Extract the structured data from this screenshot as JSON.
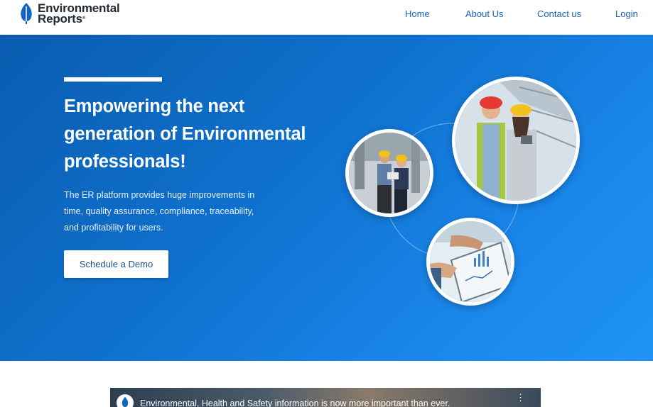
{
  "logo": {
    "line1": "Environmental",
    "line2": "Reports",
    "mark": "®"
  },
  "nav": {
    "items": [
      "Home",
      "About Us",
      "Contact us",
      "Login"
    ]
  },
  "hero": {
    "title": "Empowering the next generation of Environmental professionals!",
    "description": "The ER platform provides huge improvements in time, quality assurance, compliance, traceability, and profitability for users.",
    "cta_label": "Schedule a Demo"
  },
  "video": {
    "title": "Environmental, Health and Safety information is now more important than ever."
  },
  "colors": {
    "brand_blue": "#1565c0",
    "hero_start": "#0a5cb0",
    "hero_end": "#1f93f5"
  },
  "icons": [
    "leaf-logo-icon",
    "video-menu-icon"
  ]
}
